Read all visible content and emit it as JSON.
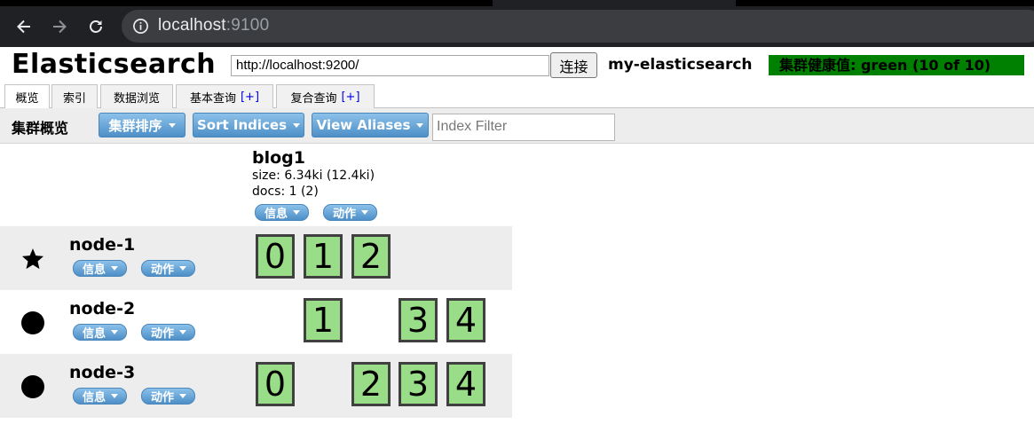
{
  "browser": {
    "url_host": "localhost",
    "url_port": ":9100"
  },
  "app": {
    "title": "Elasticsearch",
    "connect_url": "http://localhost:9200/",
    "connect_button": "连接",
    "cluster_name": "my-elasticsearch",
    "health": "集群健康值: green (10 of 10)",
    "health_color": "#008000"
  },
  "tabs": [
    {
      "label": "概览",
      "plus": ""
    },
    {
      "label": "索引",
      "plus": ""
    },
    {
      "label": "数据浏览",
      "plus": ""
    },
    {
      "label": "基本查询",
      "plus": "[+]"
    },
    {
      "label": "复合查询",
      "plus": "[+]"
    }
  ],
  "toolbar": {
    "overview_label": "集群概览",
    "sort_cluster": "集群排序",
    "sort_indices": "Sort Indices",
    "view_aliases": "View Aliases",
    "index_filter_placeholder": "Index Filter"
  },
  "index": {
    "name": "blog1",
    "size": "size: 6.34ki (12.4ki)",
    "docs": "docs: 1 (2)",
    "info_button": "信息",
    "action_button": "动作"
  },
  "nodes": [
    {
      "name": "node-1",
      "marker": "star-icon",
      "info_button": "信息",
      "action_button": "动作",
      "shards": [
        "0",
        "1",
        "2",
        "",
        ""
      ]
    },
    {
      "name": "node-2",
      "marker": "circle-icon",
      "info_button": "信息",
      "action_button": "动作",
      "shards": [
        "",
        "1",
        "",
        "3",
        "4"
      ]
    },
    {
      "name": "node-3",
      "marker": "circle-icon",
      "info_button": "信息",
      "action_button": "动作",
      "shards": [
        "0",
        "",
        "2",
        "3",
        "4"
      ]
    }
  ],
  "colors": {
    "shard_fill": "#99dd88",
    "button_blue": "#4d8fc7"
  }
}
